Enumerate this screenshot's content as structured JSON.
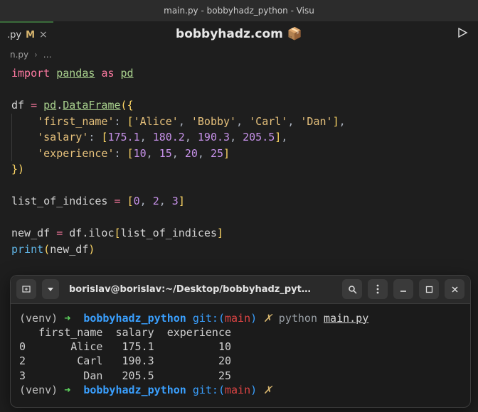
{
  "window": {
    "title": "main.py - bobbyhadz_python - Visu"
  },
  "tab": {
    "name": ".py",
    "modified": "M"
  },
  "brand": {
    "text": "bobbyhadz.com",
    "emoji": "📦"
  },
  "breadcrumbs": {
    "file": "n.py",
    "sep": "›",
    "more": "…"
  },
  "code": {
    "l1": {
      "import": "import",
      "module": "pandas",
      "as": "as",
      "alias": "pd"
    },
    "l3": {
      "var": "df",
      "eq": "=",
      "obj": "pd",
      "cls": "DataFrame"
    },
    "l4": {
      "key": "'first_name'",
      "v1": "'Alice'",
      "v2": "'Bobby'",
      "v3": "'Carl'",
      "v4": "'Dan'"
    },
    "l5": {
      "key": "'salary'",
      "v1": "175.1",
      "v2": "180.2",
      "v3": "190.3",
      "v4": "205.5"
    },
    "l6": {
      "key": "'experience'",
      "v1": "10",
      "v2": "15",
      "v3": "20",
      "v4": "25"
    },
    "l9": {
      "var": "list_of_indices",
      "eq": "=",
      "v1": "0",
      "v2": "2",
      "v3": "3"
    },
    "l11": {
      "var": "new_df",
      "eq": "=",
      "obj": "df",
      "attr": "iloc",
      "arg": "list_of_indices"
    },
    "l12": {
      "fn": "print",
      "arg": "new_df"
    }
  },
  "terminal": {
    "title": "borislav@borislav:~/Desktop/bobbyhadz_pyt…",
    "venv": "(venv)",
    "arrow": "➜",
    "cwd": "bobbyhadz_python",
    "git": "git:(",
    "branch": "main",
    "gitclose": ")",
    "x": "✗",
    "cmd": "python",
    "file": "main.py",
    "out_header": "   first_name  salary  experience",
    "out_r1": "0       Alice   175.1          10",
    "out_r2": "2        Carl   190.3          20",
    "out_r3": "3         Dan   205.5          25"
  },
  "chart_data": {
    "type": "table",
    "columns": [
      "",
      "first_name",
      "salary",
      "experience"
    ],
    "rows": [
      [
        0,
        "Alice",
        175.1,
        10
      ],
      [
        2,
        "Carl",
        190.3,
        20
      ],
      [
        3,
        "Dan",
        205.5,
        25
      ]
    ]
  }
}
